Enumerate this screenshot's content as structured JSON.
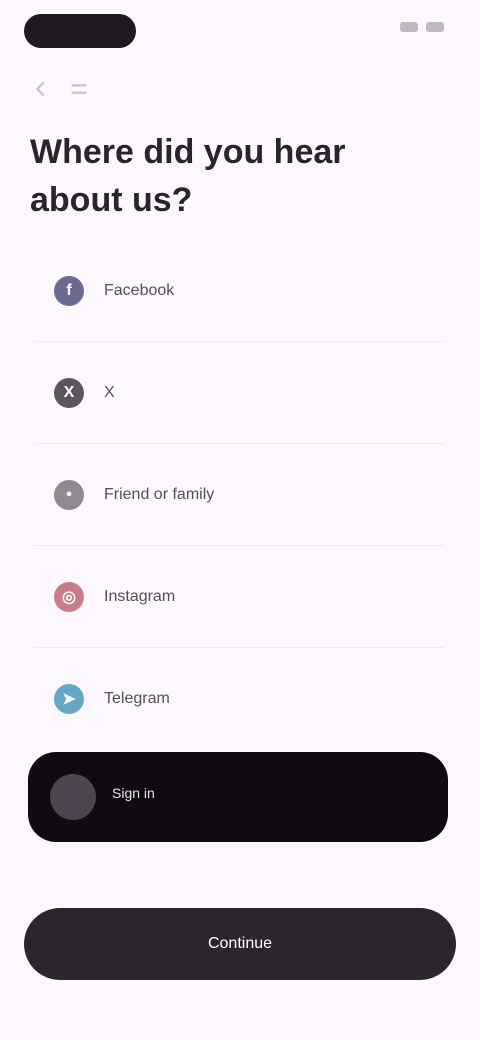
{
  "status_bar": {
    "pill": "",
    "time": ""
  },
  "header": {
    "title": "Where did you hear about us?"
  },
  "options": [
    {
      "label": "Facebook",
      "icon": "facebook-icon",
      "color": "#6c6a93"
    },
    {
      "label": "X",
      "icon": "x-icon",
      "color": "#5b565d"
    },
    {
      "label": "Friend or family",
      "icon": "people-icon",
      "color": "#8f8993"
    },
    {
      "label": "Instagram",
      "icon": "instagram-icon",
      "color": "#c77c87"
    },
    {
      "label": "Telegram",
      "icon": "telegram-icon",
      "color": "#66a7c8"
    }
  ],
  "account_card": {
    "name": "Sign in",
    "email": ""
  },
  "continue_button": {
    "label": "Continue"
  },
  "colors": {
    "background": "#fcf8fd",
    "dark": "#0f0b11",
    "button": "#2b262d"
  }
}
